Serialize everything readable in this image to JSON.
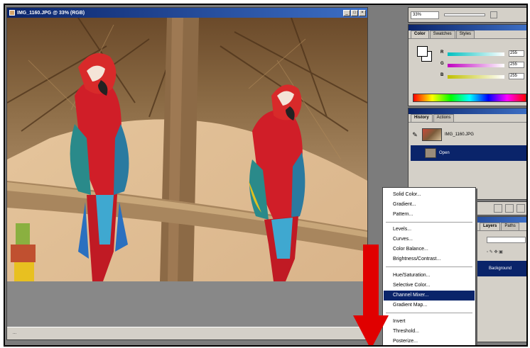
{
  "document": {
    "title": "IMG_1160.JPG @ 33% (RGB)",
    "status_text": "..."
  },
  "navigator": {
    "zoom": "33%"
  },
  "color_palette": {
    "tabs": [
      "Color",
      "Swatches",
      "Styles"
    ],
    "channels": [
      {
        "label": "R",
        "value": "255"
      },
      {
        "label": "G",
        "value": "255"
      },
      {
        "label": "B",
        "value": "255"
      }
    ]
  },
  "history_palette": {
    "tabs": [
      "History",
      "Actions"
    ],
    "snapshot_label": "IMG_1160.JPG",
    "states": [
      "Open"
    ]
  },
  "layers_palette": {
    "tabs": [
      "Layers",
      "Paths"
    ],
    "selected_layer": "Background"
  },
  "context_menu": {
    "items": [
      "Solid Color...",
      "Gradient...",
      "Pattern...",
      "Levels...",
      "Curves...",
      "Color Balance...",
      "Brightness/Contrast...",
      "Hue/Saturation...",
      "Selective Color...",
      "Channel Mixer...",
      "Gradient Map...",
      "Invert",
      "Threshold...",
      "Posterize..."
    ],
    "highlighted": "Channel Mixer..."
  },
  "annotation": {
    "arrow_color": "#e00000"
  },
  "colors": {
    "titlebar": "#0a246a",
    "menu_highlight": "#0a246a",
    "panel_bg": "#d4d0c8"
  }
}
